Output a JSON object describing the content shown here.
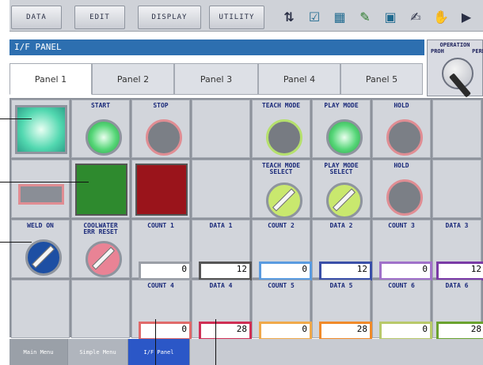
{
  "menu": {
    "items": [
      "DATA",
      "EDIT",
      "DISPLAY",
      "UTILITY"
    ]
  },
  "toolbar": {
    "icons": [
      "coordinate-icon",
      "edit-icon",
      "chart-icon",
      "job-icon",
      "monitor-icon",
      "pen-icon",
      "hand-icon",
      "play-icon"
    ]
  },
  "title": "I/F PANEL",
  "operation": {
    "label": "OPERATION",
    "left": "PROH",
    "right": "PERM"
  },
  "panel_tabs": [
    "Panel 1",
    "Panel 2",
    "Panel 3",
    "Panel 4",
    "Panel 5"
  ],
  "row1": {
    "start": "START",
    "stop": "STOP",
    "teach_mode": "TEACH MODE",
    "play_mode": "PLAY MODE",
    "hold": "HOLD"
  },
  "row2": {
    "teach_select": "TEACH MODE\nSELECT",
    "play_select": "PLAY MODE\nSELECT",
    "hold": "HOLD"
  },
  "row3": {
    "weld_on": "WELD ON",
    "cool_water": "COOLWATER\nERR RESET",
    "count1": "COUNT 1",
    "count1_val": "0",
    "data1": "DATA 1",
    "data1_val": "12",
    "count2": "COUNT 2",
    "count2_val": "0",
    "data2": "DATA 2",
    "data2_val": "12",
    "count3": "COUNT 3",
    "count3_val": "0",
    "data3": "DATA 3",
    "data3_val": "12"
  },
  "row4": {
    "count4": "COUNT 4",
    "count4_val": "0",
    "data4": "DATA 4",
    "data4_val": "28",
    "count5": "COUNT 5",
    "count5_val": "0",
    "data5": "DATA 5",
    "data5_val": "28",
    "count6": "COUNT 6",
    "count6_val": "0",
    "data6": "DATA 6",
    "data6_val": "28"
  },
  "bottom_tabs": [
    "Main Menu",
    "Simple Menu",
    "I/F Panel"
  ],
  "colors": {
    "title_blue": "#2d6fb0",
    "active_tab": "#2b57c7",
    "green_lamp": "#44d06a",
    "red_lamp": "#c83a3a"
  }
}
